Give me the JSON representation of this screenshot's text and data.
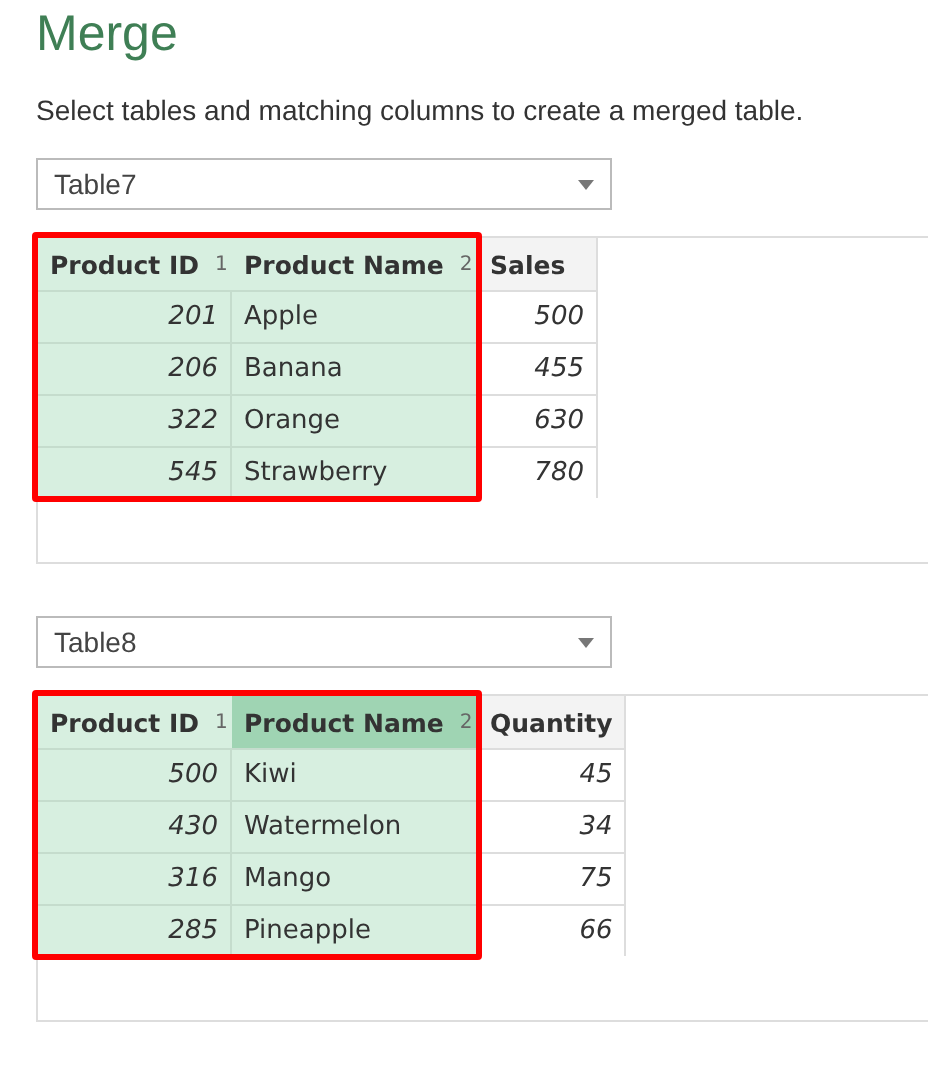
{
  "title": "Merge",
  "instructions": "Select tables and matching columns to create a merged table.",
  "tables": [
    {
      "dropdown": "Table7",
      "columns": [
        {
          "label": "Product ID",
          "kind": "number",
          "selected": true,
          "order": "1",
          "focused": false,
          "cells": [
            "201",
            "206",
            "322",
            "545"
          ]
        },
        {
          "label": "Product Name",
          "kind": "text",
          "selected": true,
          "order": "2",
          "focused": false,
          "cells": [
            "Apple",
            "Banana",
            "Orange",
            "Strawberry"
          ]
        },
        {
          "label": "Sales",
          "kind": "number",
          "selected": false,
          "focused": false,
          "cells": [
            "500",
            "455",
            "630",
            "780"
          ]
        }
      ]
    },
    {
      "dropdown": "Table8",
      "columns": [
        {
          "label": "Product ID",
          "kind": "number",
          "selected": true,
          "order": "1",
          "focused": false,
          "cells": [
            "500",
            "430",
            "316",
            "285"
          ]
        },
        {
          "label": "Product Name",
          "kind": "text",
          "selected": true,
          "order": "2",
          "focused": true,
          "cells": [
            "Kiwi",
            "Watermelon",
            "Mango",
            "Pineapple"
          ]
        },
        {
          "label": "Quantity",
          "kind": "number",
          "selected": false,
          "focused": false,
          "cells": [
            "45",
            "34",
            "75",
            "66"
          ]
        }
      ]
    }
  ]
}
